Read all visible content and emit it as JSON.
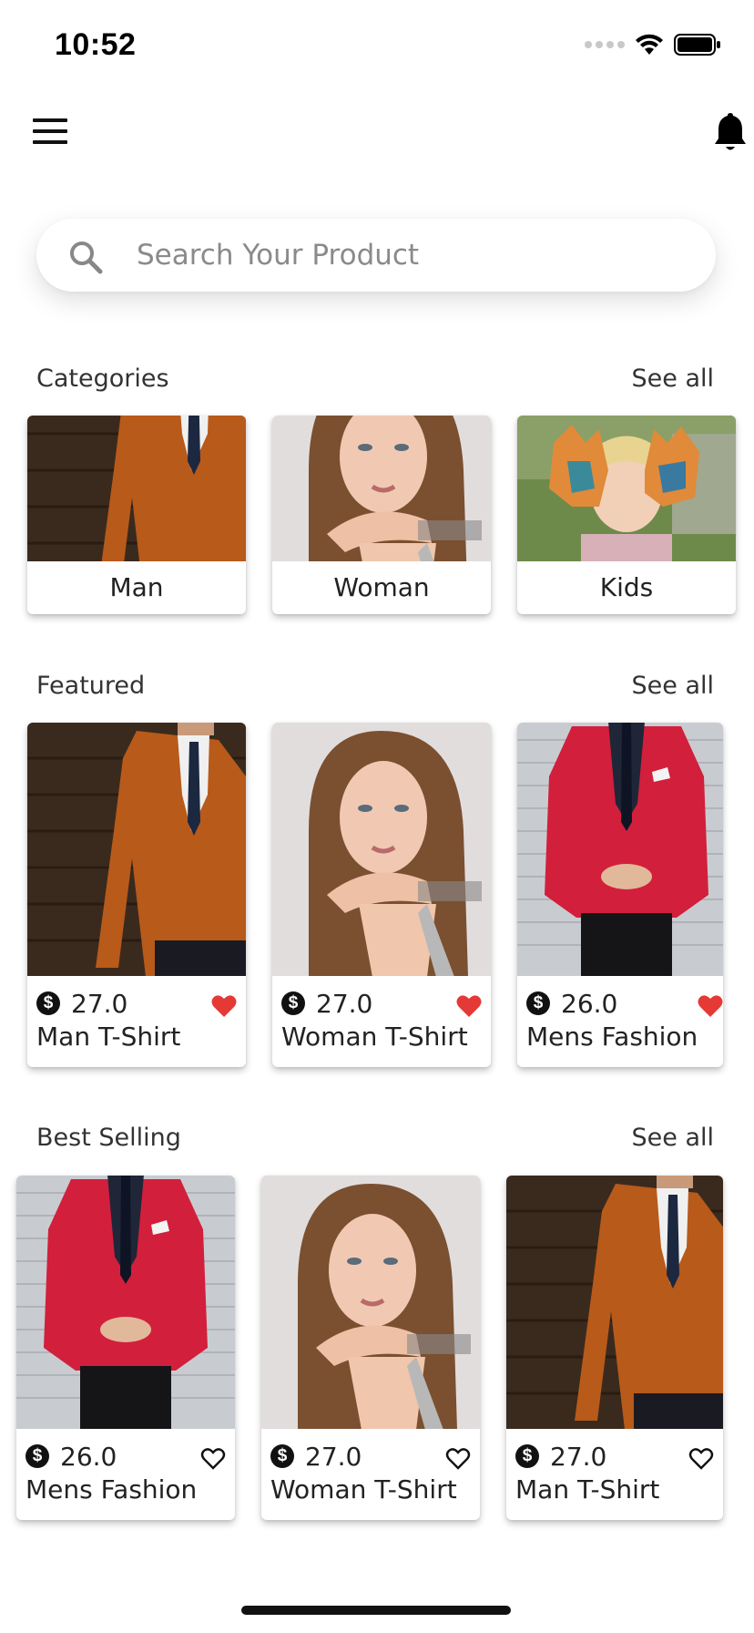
{
  "status_bar": {
    "time": "10:52"
  },
  "search": {
    "placeholder": "Search Your Product"
  },
  "sections": {
    "categories": {
      "title": "Categories",
      "see_all": "See all"
    },
    "featured": {
      "title": "Featured",
      "see_all": "See all"
    },
    "best_selling": {
      "title": "Best Selling",
      "see_all": "See all"
    }
  },
  "categories": [
    {
      "label": "Man",
      "image": "man-orange-blazer"
    },
    {
      "label": "Woman",
      "image": "woman-portrait"
    },
    {
      "label": "Kids",
      "image": "kid-painted-hands"
    }
  ],
  "featured": [
    {
      "price": "27.0",
      "name": "Man T-Shirt",
      "favorite": true,
      "image": "man-orange-blazer"
    },
    {
      "price": "27.0",
      "name": "Woman T-Shirt",
      "favorite": true,
      "image": "woman-portrait"
    },
    {
      "price": "26.0",
      "name": "Mens Fashion",
      "favorite": true,
      "image": "man-red-blazer"
    }
  ],
  "best_selling": [
    {
      "price": "26.0",
      "name": "Mens Fashion",
      "favorite": false,
      "image": "man-red-blazer"
    },
    {
      "price": "27.0",
      "name": "Woman T-Shirt",
      "favorite": false,
      "image": "woman-portrait"
    },
    {
      "price": "27.0",
      "name": "Man T-Shirt",
      "favorite": false,
      "image": "man-orange-blazer"
    }
  ],
  "icons": {
    "menu": "hamburger-menu-icon",
    "notifications": "bell-icon",
    "search": "search-icon",
    "currency": "dollar-circle-icon",
    "favorite": "heart-icon"
  },
  "colors": {
    "heart_filled": "#e53935",
    "text": "#222222"
  }
}
